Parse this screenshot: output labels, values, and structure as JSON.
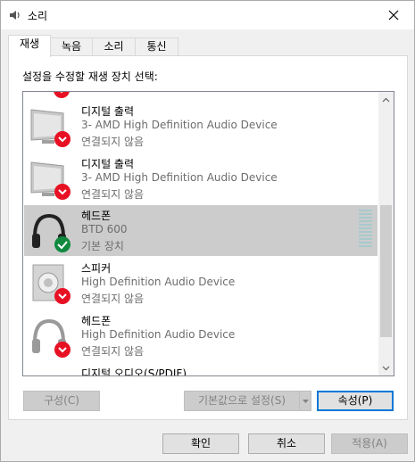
{
  "window": {
    "title": "소리",
    "close_icon": "close-icon"
  },
  "tabs": [
    {
      "label": "재생",
      "active": true
    },
    {
      "label": "녹음",
      "active": false
    },
    {
      "label": "소리",
      "active": false
    },
    {
      "label": "통신",
      "active": false
    }
  ],
  "instruction": "설정을 수정할 재생 장치 선택:",
  "devices": [
    {
      "name": "디지털 출력",
      "description": "3- AMD High Definition Audio Device",
      "status": "연결되지 않음",
      "icon": "monitor-icon",
      "status_icon": "disconnected-icon",
      "selected": false
    },
    {
      "name": "디지털 출력",
      "description": "3- AMD High Definition Audio Device",
      "status": "연결되지 않음",
      "icon": "monitor-icon",
      "status_icon": "disconnected-icon",
      "selected": false
    },
    {
      "name": "헤드폰",
      "description": "BTD 600",
      "status": "기본 장치",
      "icon": "headphones-icon",
      "status_icon": "default-check-icon",
      "selected": true
    },
    {
      "name": "스피커",
      "description": "High Definition Audio Device",
      "status": "연결되지 않음",
      "icon": "speaker-icon",
      "status_icon": "disconnected-icon",
      "selected": false
    },
    {
      "name": "헤드폰",
      "description": "High Definition Audio Device",
      "status": "연결되지 않음",
      "icon": "headphones-icon",
      "status_icon": "disconnected-icon",
      "selected": false
    },
    {
      "name": "디지털 오디오(S/PDIF)",
      "description": "",
      "status": "",
      "icon": "monitor-icon",
      "status_icon": "",
      "selected": false
    }
  ],
  "buttons": {
    "configure": "구성(C)",
    "set_default": "기본값으로 설정(S)",
    "properties": "속성(P)",
    "ok": "확인",
    "cancel": "취소",
    "apply": "적용(A)"
  },
  "colors": {
    "accent": "#0078d7",
    "ok_green": "#10893e",
    "error_red": "#e81123"
  }
}
